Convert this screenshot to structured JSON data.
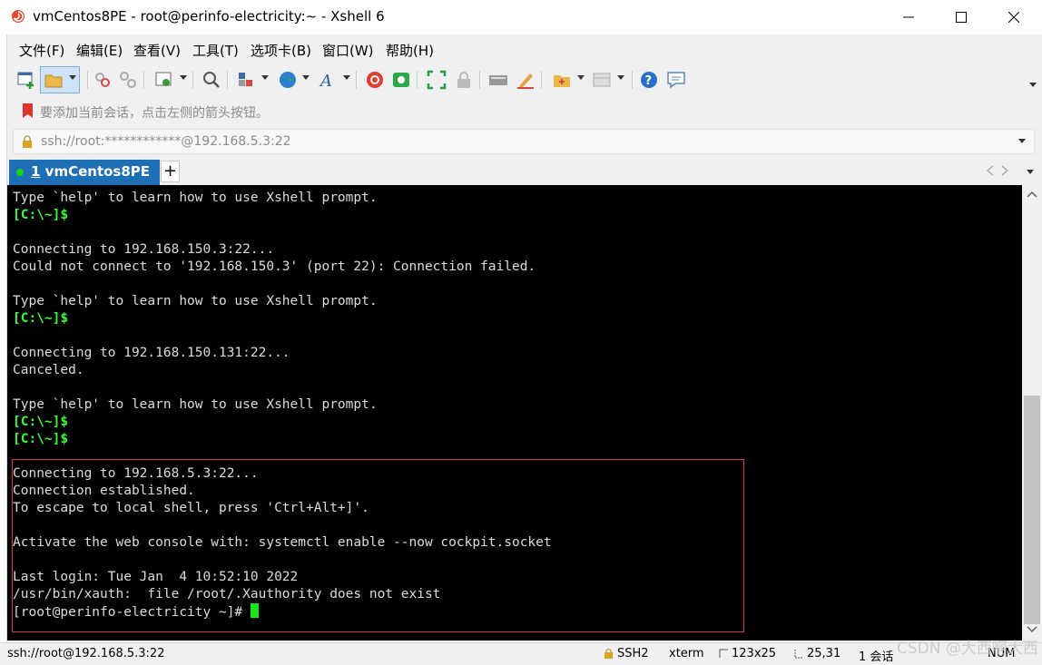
{
  "window": {
    "title": "vmCentos8PE - root@perinfo-electricity:~ - Xshell 6",
    "minimize": "─",
    "maximize": "☐",
    "close": "✕"
  },
  "menu": [
    "文件(F)",
    "编辑(E)",
    "查看(V)",
    "工具(T)",
    "选项卡(B)",
    "窗口(W)",
    "帮助(H)"
  ],
  "hint": "要添加当前会话，点击左侧的箭头按钮。",
  "address": "ssh://root:************@192.168.5.3:22",
  "tab": {
    "number": "1",
    "label": "vmCentos8PE",
    "add": "+"
  },
  "terminal": {
    "lines": [
      "Type `help' to learn how to use Xshell prompt.",
      "[C:\\~]$",
      "",
      "Connecting to 192.168.150.3:22...",
      "Could not connect to '192.168.150.3' (port 22): Connection failed.",
      "",
      "Type `help' to learn how to use Xshell prompt.",
      "[C:\\~]$",
      "",
      "Connecting to 192.168.150.131:22...",
      "Canceled.",
      "",
      "Type `help' to learn how to use Xshell prompt.",
      "[C:\\~]$",
      "[C:\\~]$",
      "",
      "Connecting to 192.168.5.3:22...",
      "Connection established.",
      "To escape to local shell, press 'Ctrl+Alt+]'.",
      "",
      "Activate the web console with: systemctl enable --now cockpit.socket",
      "",
      "Last login: Tue Jan  4 10:52:10 2022",
      "/usr/bin/xauth:  file /root/.Xauthority does not exist",
      "[root@perinfo-electricity ~]# "
    ]
  },
  "status": {
    "session": "ssh://root@192.168.5.3:22",
    "protocol": "SSH2",
    "term": "xterm",
    "size": "123x25",
    "cursor_pos": "25,31",
    "sessions": "1 会话",
    "num": "NUM"
  },
  "watermark": "CSDN @大西啊大西",
  "colors": {
    "tab_active": "#1e6fb5",
    "terminal_bg": "#000000",
    "prompt": "#32ff32",
    "highlight_border": "#d83838"
  }
}
